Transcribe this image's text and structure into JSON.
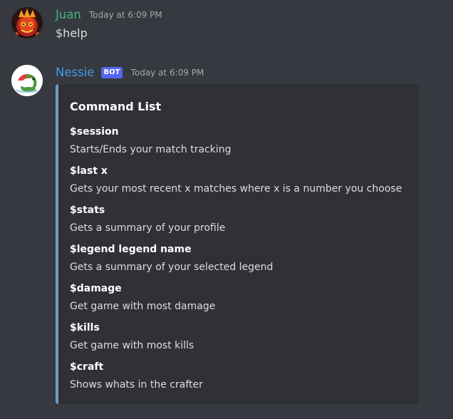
{
  "messages": [
    {
      "author": "Juan",
      "timestamp": "Today at 6:09 PM",
      "text": "$help"
    },
    {
      "author": "Nessie",
      "bot_tag": "BOT",
      "timestamp": "Today at 6:09 PM",
      "embed": {
        "title": "Command List",
        "accent_color": "#6c9fc4",
        "fields": [
          {
            "name": "$session",
            "value": "Starts/Ends your match tracking"
          },
          {
            "name": "$last x",
            "value": "Gets your most recent x matches where x is a number you choose"
          },
          {
            "name": "$stats",
            "value": "Gets a summary of your profile"
          },
          {
            "name": "$legend legend name",
            "value": "Gets a summary of your selected legend"
          },
          {
            "name": "$damage",
            "value": "Get game with most damage"
          },
          {
            "name": "$kills",
            "value": "Get game with most kills"
          },
          {
            "name": "$craft",
            "value": "Shows whats in the crafter"
          }
        ]
      }
    }
  ],
  "colors": {
    "background": "#36393f",
    "embed_background": "#2f3136",
    "juan_name": "#43b581",
    "nessie_name": "#3f9fe8",
    "bot_tag": "#5865f2"
  },
  "icons": {
    "juan_avatar": "red-creature-avatar-icon",
    "nessie_avatar": "nessie-dinosaur-avatar-icon"
  }
}
